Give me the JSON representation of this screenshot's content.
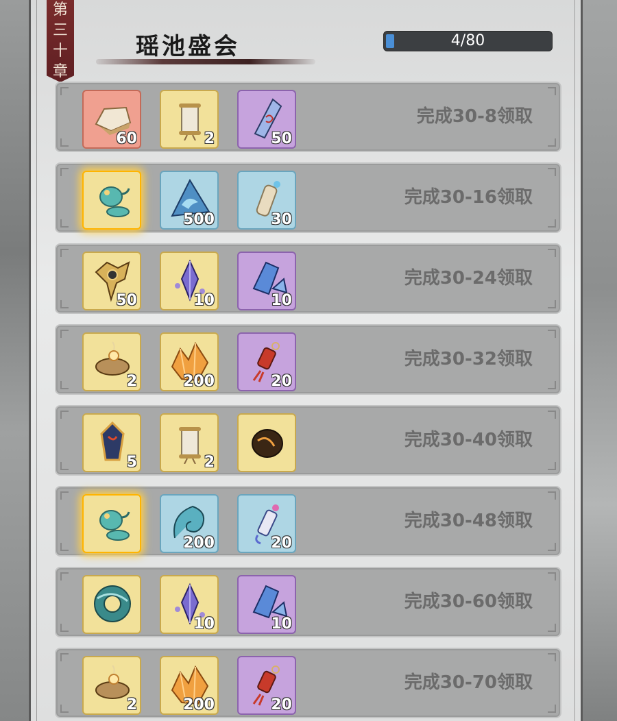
{
  "chapter": "第三十章",
  "title": "瑶池盛会",
  "progress": {
    "text": "4/80",
    "value": 0.05
  },
  "rows": [
    {
      "condition": "完成30-8领取",
      "items": [
        {
          "icon": "ingot-icon",
          "frame": "red",
          "qty": "60"
        },
        {
          "icon": "scroll-icon",
          "frame": "gold",
          "qty": "2"
        },
        {
          "icon": "talisman-blade-icon",
          "frame": "purple",
          "qty": "50"
        }
      ]
    },
    {
      "condition": "完成30-16领取",
      "items": [
        {
          "icon": "teapot-icon",
          "frame": "gold",
          "glow": true,
          "qty": ""
        },
        {
          "icon": "wave-shard-icon",
          "frame": "blue",
          "qty": "500"
        },
        {
          "icon": "small-scroll-icon",
          "frame": "blue",
          "qty": "30"
        }
      ]
    },
    {
      "condition": "完成30-24领取",
      "items": [
        {
          "icon": "emblem-icon",
          "frame": "gold",
          "qty": "50"
        },
        {
          "icon": "crystal-icon",
          "frame": "gold",
          "qty": "10"
        },
        {
          "icon": "crystal-cluster-icon",
          "frame": "purple",
          "qty": "10"
        }
      ]
    },
    {
      "condition": "完成30-32领取",
      "items": [
        {
          "icon": "lamp-icon",
          "frame": "gold",
          "qty": "2"
        },
        {
          "icon": "amber-crystal-icon",
          "frame": "gold",
          "qty": "200"
        },
        {
          "icon": "red-charm-icon",
          "frame": "purple",
          "qty": "20"
        }
      ]
    },
    {
      "condition": "完成30-40领取",
      "items": [
        {
          "icon": "amulet-icon",
          "frame": "gold",
          "qty": "5"
        },
        {
          "icon": "scroll-icon",
          "frame": "gold",
          "qty": "2"
        },
        {
          "icon": "dark-orb-icon",
          "frame": "gold",
          "qty": ""
        }
      ]
    },
    {
      "condition": "完成30-48领取",
      "items": [
        {
          "icon": "teapot-icon",
          "frame": "gold",
          "glow": true,
          "qty": ""
        },
        {
          "icon": "swirl-icon",
          "frame": "blue",
          "qty": "200"
        },
        {
          "icon": "ribbon-charm-icon",
          "frame": "blue",
          "qty": "20"
        }
      ]
    },
    {
      "condition": "完成30-60领取",
      "items": [
        {
          "icon": "ring-token-icon",
          "frame": "gold",
          "qty": ""
        },
        {
          "icon": "crystal-icon",
          "frame": "gold",
          "qty": "10"
        },
        {
          "icon": "crystal-cluster-icon",
          "frame": "purple",
          "qty": "10"
        }
      ]
    },
    {
      "condition": "完成30-70领取",
      "items": [
        {
          "icon": "lamp-icon",
          "frame": "gold",
          "qty": "2"
        },
        {
          "icon": "amber-crystal-icon",
          "frame": "gold",
          "qty": "200"
        },
        {
          "icon": "red-charm-icon",
          "frame": "purple",
          "qty": "20"
        }
      ]
    }
  ],
  "colors": {
    "progress_fill": "#4a8fd6",
    "chapter_tag": "#6b2527"
  }
}
